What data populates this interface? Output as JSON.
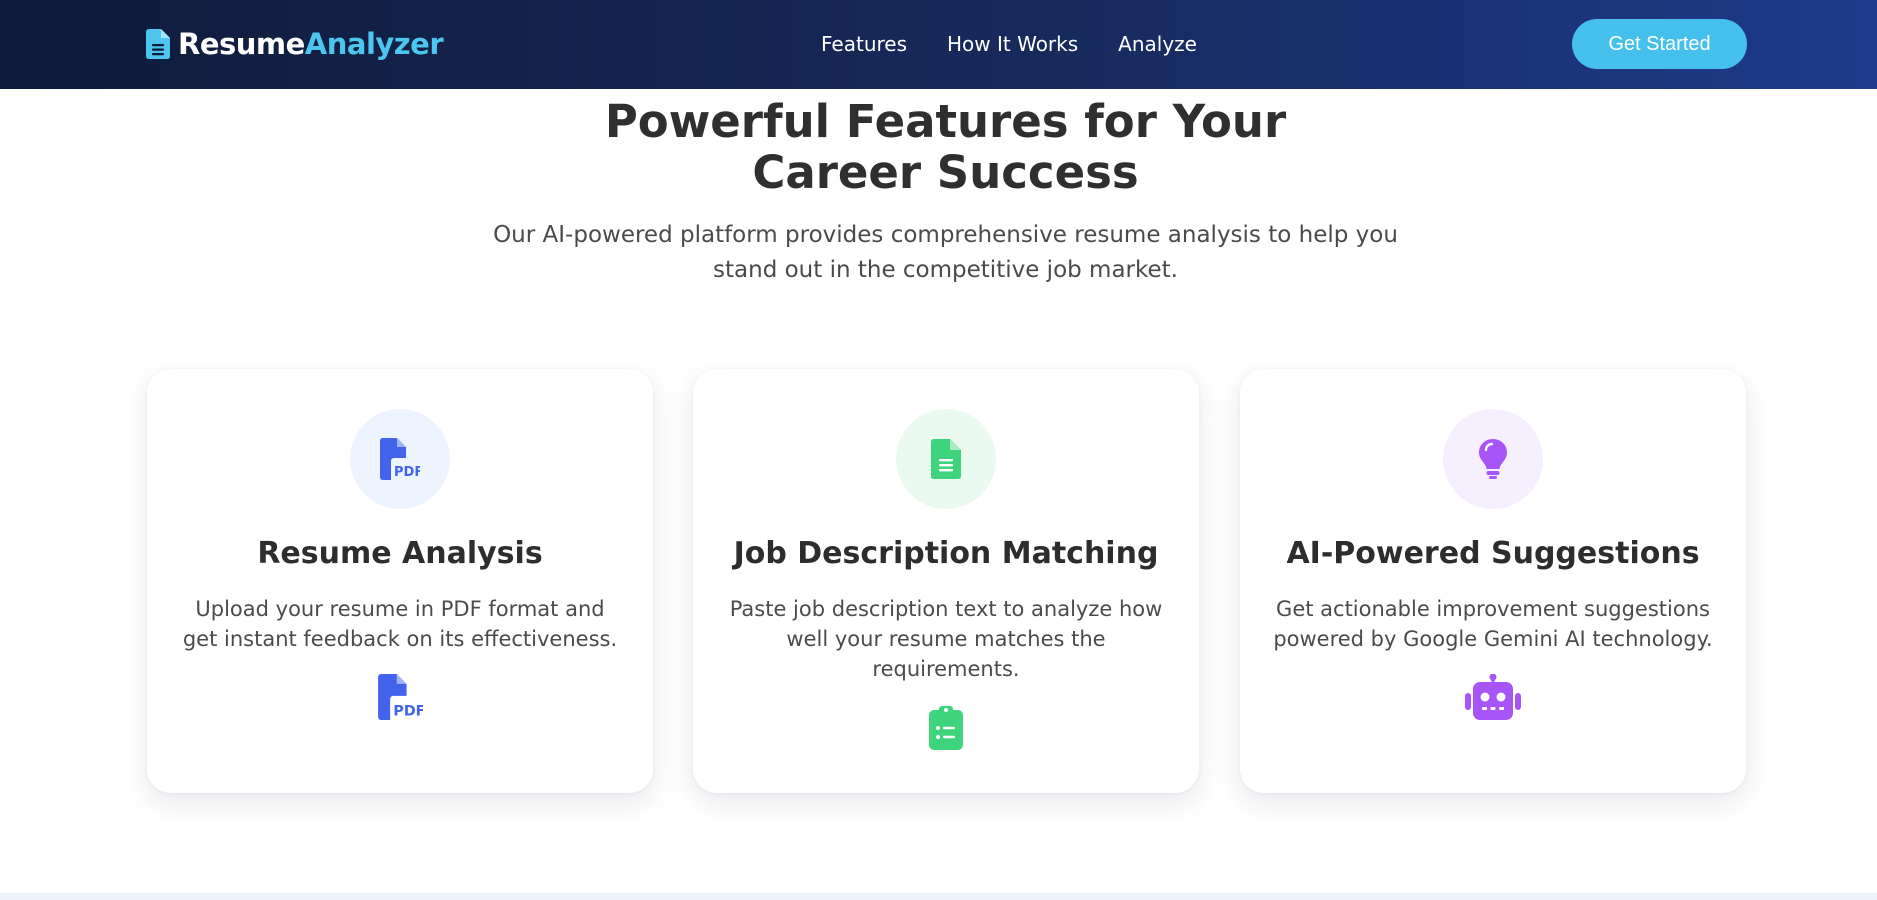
{
  "brand": {
    "name_part1": "Resume",
    "name_part2": "Analyzer",
    "icon": "file-icon"
  },
  "nav": {
    "links": [
      "Features",
      "How It Works",
      "Analyze"
    ],
    "cta_label": "Get Started"
  },
  "hero": {
    "title": "Powerful Features for Your Career Success",
    "subtitle": "Our AI-powered platform provides comprehensive resume analysis to help you stand out in the competitive job market."
  },
  "cards": [
    {
      "title": "Resume Analysis",
      "description": "Upload your resume in PDF format and get instant feedback on its effectiveness.",
      "top_icon": "file-pdf-icon",
      "bottom_icon": "file-pdf-icon",
      "color": "#4263eb",
      "bg": "#eef4ff"
    },
    {
      "title": "Job Description Matching",
      "description": "Paste job description text to analyze how well your resume matches the requirements.",
      "top_icon": "file-text-icon",
      "bottom_icon": "clipboard-list-icon",
      "color": "#3dd47c",
      "bg": "#eafaf0"
    },
    {
      "title": "AI-Powered Suggestions",
      "description": "Get actionable improvement suggestions powered by Google Gemini AI technology.",
      "top_icon": "lightbulb-icon",
      "bottom_icon": "robot-icon",
      "color": "#a855f7",
      "bg": "#f6efff"
    }
  ],
  "colors": {
    "nav_gradient_start": "#0f1b3a",
    "nav_gradient_end": "#1e3a8a",
    "accent": "#4cc6ee",
    "cta_bg": "#45c0ec"
  }
}
